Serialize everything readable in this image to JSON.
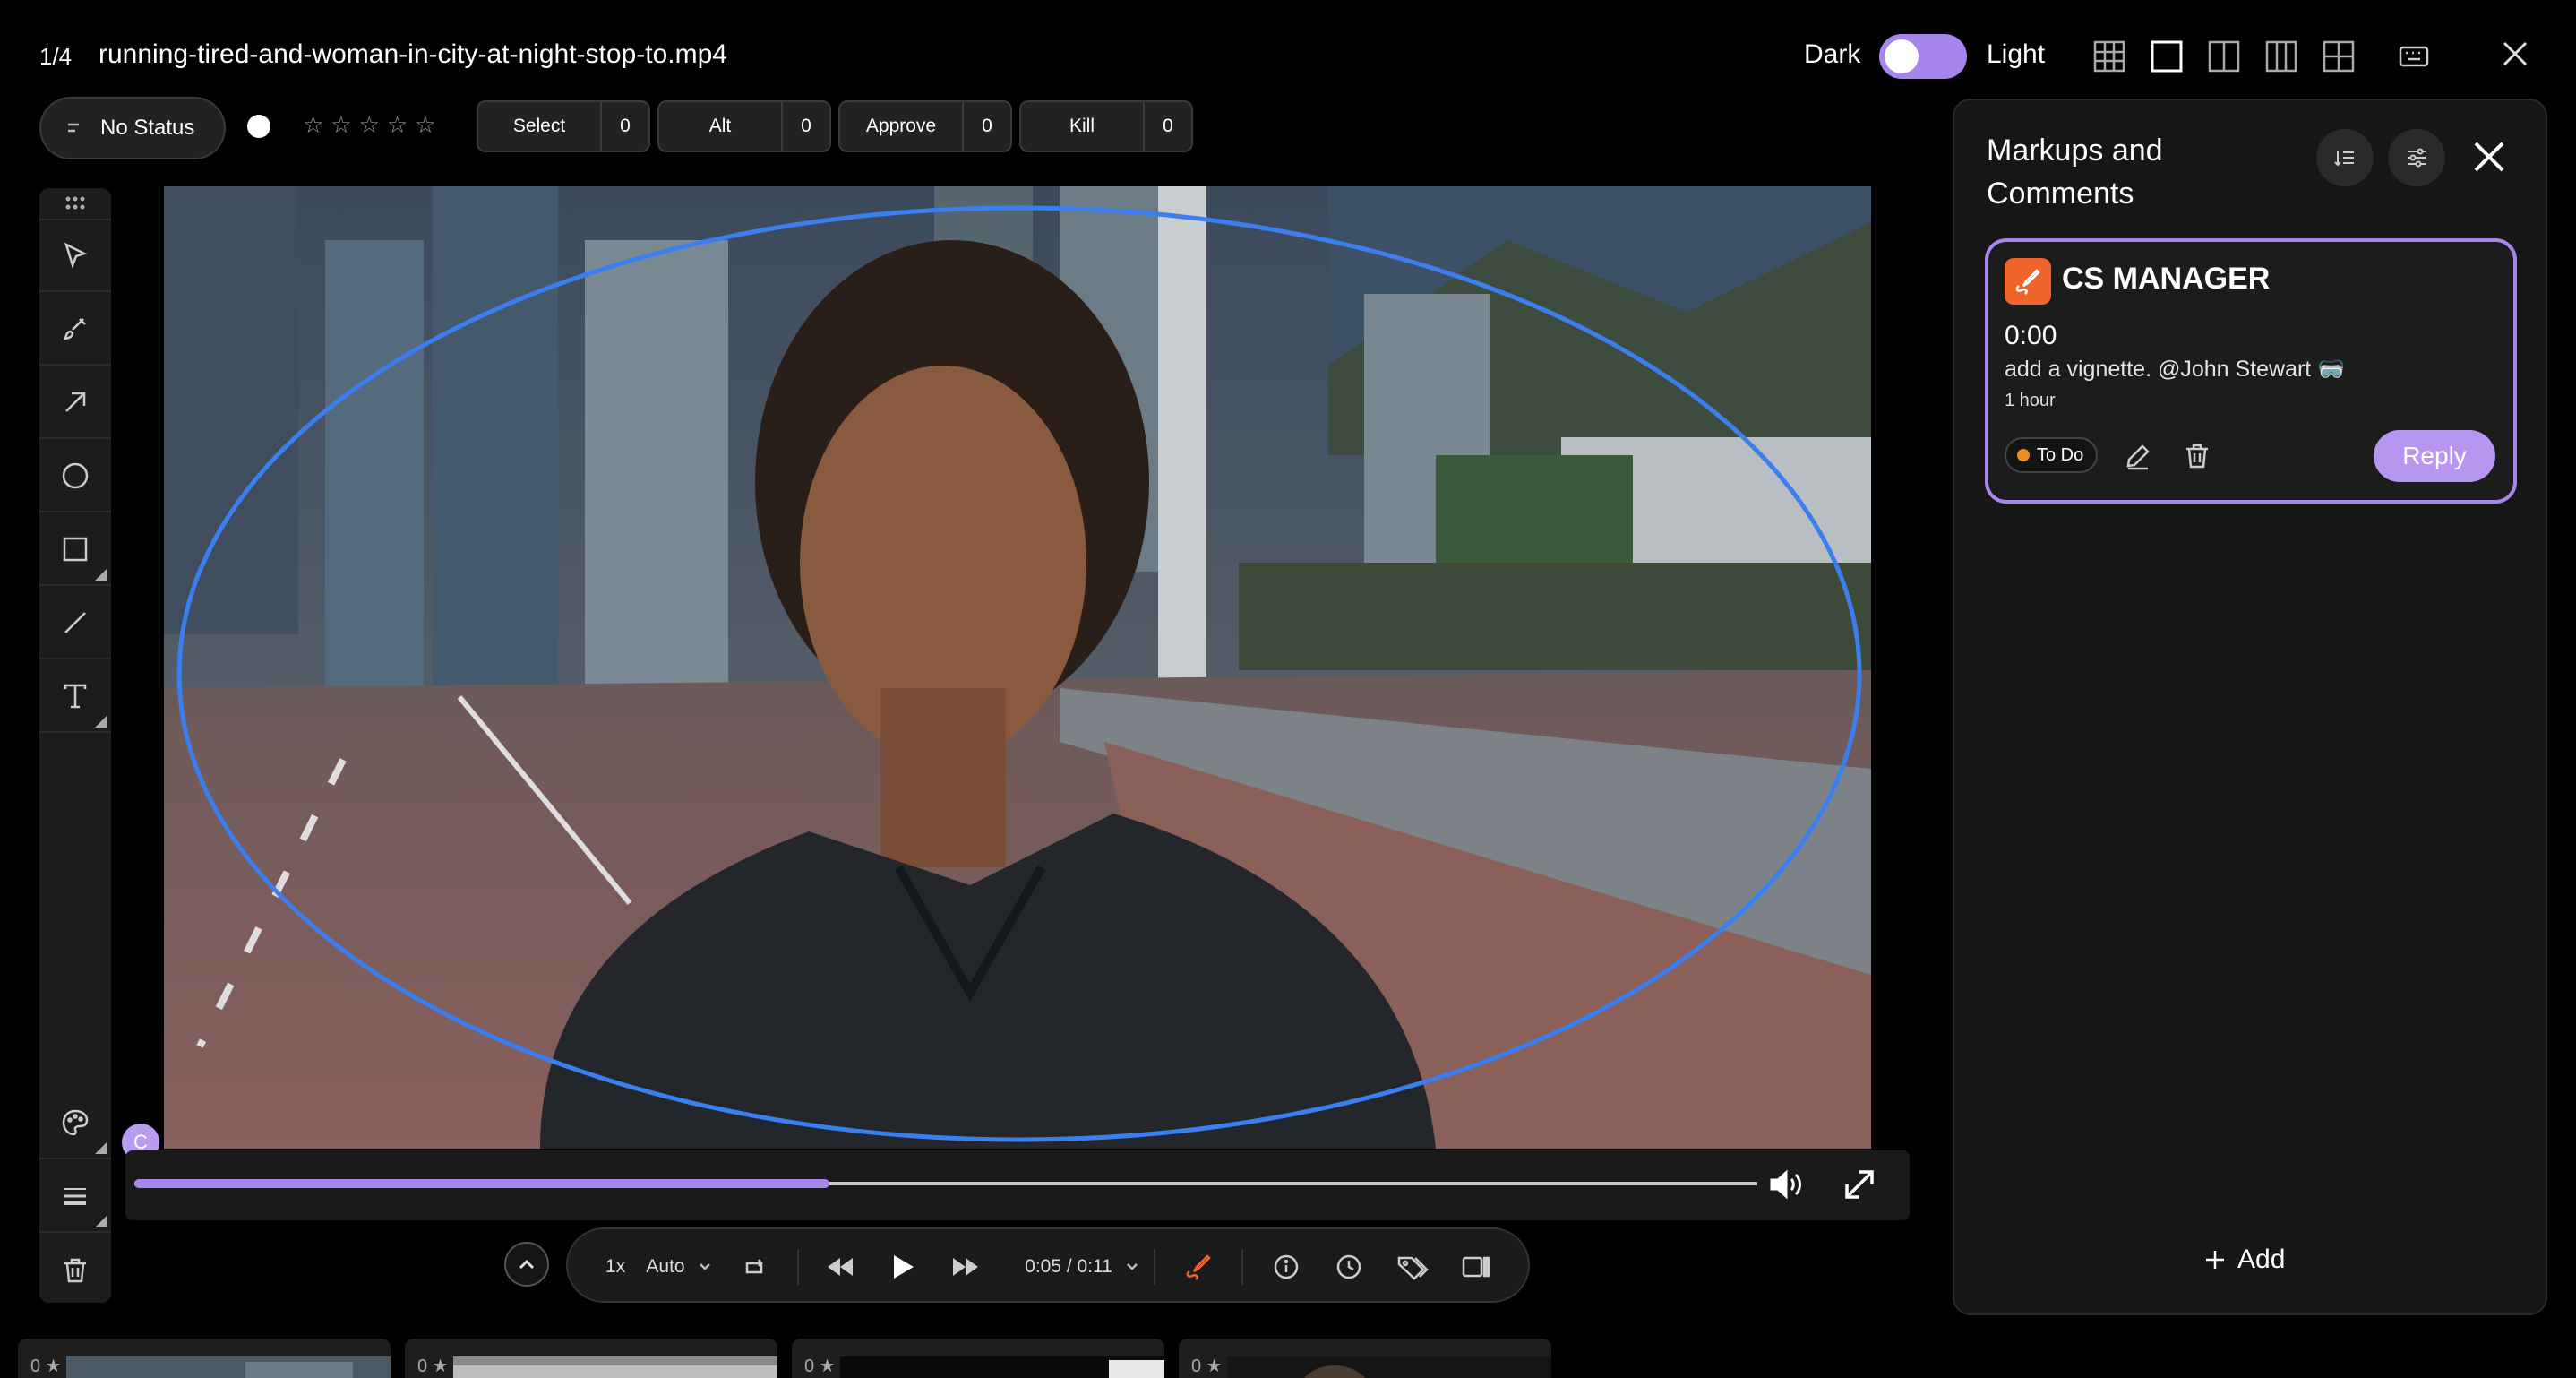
{
  "header": {
    "counter": "1/4",
    "filename": "running-tired-and-woman-in-city-at-night-stop-to.mp4",
    "theme_dark_label": "Dark",
    "theme_light_label": "Light"
  },
  "status": {
    "label": "No Status",
    "rating_stars": "☆☆☆☆☆",
    "buttons": [
      {
        "label": "Select",
        "count": "0"
      },
      {
        "label": "Alt",
        "count": "0"
      },
      {
        "label": "Approve",
        "count": "0"
      },
      {
        "label": "Kill",
        "count": "0"
      }
    ]
  },
  "video": {
    "avatar_initial": "C",
    "progress": 0.428
  },
  "controls": {
    "speed": "1x",
    "quality": "Auto",
    "time": "0:05 / 0:11"
  },
  "panel": {
    "title": "Markups and Comments",
    "comment": {
      "author": "CS MANAGER",
      "timestamp": "0:00",
      "text": "add a vignette. @John Stewart 🥽",
      "age": "1 hour",
      "status": "To Do",
      "reply_label": "Reply"
    },
    "add_label": "Add"
  },
  "thumbnails": [
    {
      "count": "0"
    },
    {
      "count": "0"
    },
    {
      "count": "0"
    },
    {
      "count": "0"
    }
  ],
  "colors": {
    "accent": "#a885ec",
    "markup_blue": "#3b7ef0",
    "todo_orange": "#f08a24",
    "author_icon": "#f0652a"
  }
}
